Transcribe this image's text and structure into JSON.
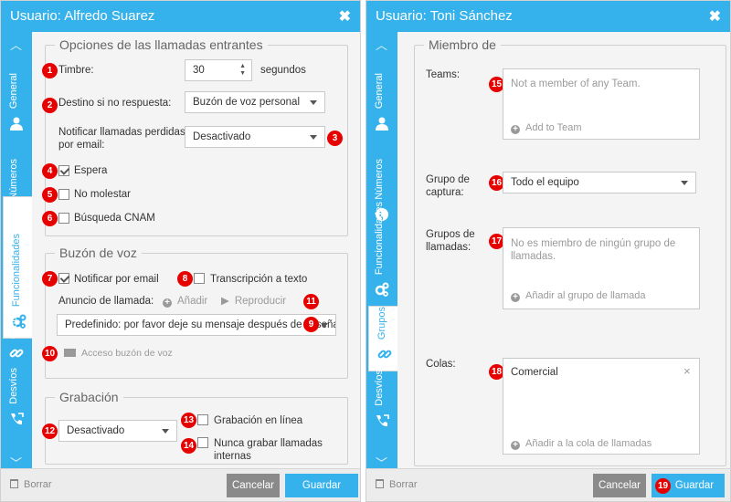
{
  "left": {
    "title": "Usuario: Alfredo Suarez",
    "tabs": [
      {
        "label": "General"
      },
      {
        "label": "Números"
      },
      {
        "label": "Funcionalidades"
      },
      {
        "label": "Grupos"
      },
      {
        "label": "Desvíos"
      }
    ],
    "incoming": {
      "legend": "Opciones de las llamadas entrantes",
      "ring_label": "Timbre:",
      "ring_value": "30",
      "ring_unit": "segundos",
      "no_answer_label": "Destino si no respuesta:",
      "no_answer_value": "Buzón de voz personal",
      "notify_missed_label": "Notificar llamadas perdidas por email:",
      "notify_missed_value": "Desactivado",
      "wait_label": "Espera",
      "dnd_label": "No molestar",
      "cnam_label": "Búsqueda CNAM"
    },
    "voicemail": {
      "legend": "Buzón de voz",
      "notify_email_label": "Notificar por email",
      "transcription_label": "Transcripción a texto",
      "announcement_label": "Anuncio de llamada:",
      "add_label": "Añadir",
      "play_label": "Reproducir",
      "announcement_value": "Predefinido: por favor deje su mensaje después de la señal",
      "access_label": "Acceso buzón de voz"
    },
    "recording": {
      "legend": "Grabación",
      "mode_value": "Desactivado",
      "online_label": "Grabación en línea",
      "never_internal_label": "Nunca grabar llamadas internas"
    },
    "footer": {
      "delete_label": "Borrar",
      "cancel_label": "Cancelar",
      "save_label": "Guardar"
    },
    "badges": [
      "1",
      "2",
      "3",
      "4",
      "5",
      "6",
      "7",
      "8",
      "9",
      "10",
      "11",
      "12",
      "13",
      "14"
    ]
  },
  "right": {
    "title": "Usuario: Toni Sánchez",
    "tabs": [
      {
        "label": "General"
      },
      {
        "label": "Números"
      },
      {
        "label": "Funcionalidades"
      },
      {
        "label": "Grupos"
      },
      {
        "label": "Desvíos"
      }
    ],
    "member": {
      "legend": "Miembro de",
      "teams_label": "Teams:",
      "teams_empty": "Not a member of any Team.",
      "teams_add": "Add to Team",
      "pickup_label": "Grupo de captura:",
      "pickup_value": "Todo el equipo",
      "call_groups_label": "Grupos de llamadas:",
      "call_groups_empty": "No es miembro de ningún grupo de llamadas.",
      "call_groups_add": "Añadir al grupo de llamada",
      "queues_label": "Colas:",
      "queue_item": "Comercial",
      "queues_add": "Añadir a la cola de llamadas"
    },
    "footer": {
      "delete_label": "Borrar",
      "cancel_label": "Cancelar",
      "save_label": "Guardar"
    },
    "badges": [
      "15",
      "16",
      "17",
      "18",
      "19"
    ]
  },
  "colors": {
    "accent": "#35b2ec",
    "badge": "#e60000",
    "panel": "#f4f4f4"
  }
}
